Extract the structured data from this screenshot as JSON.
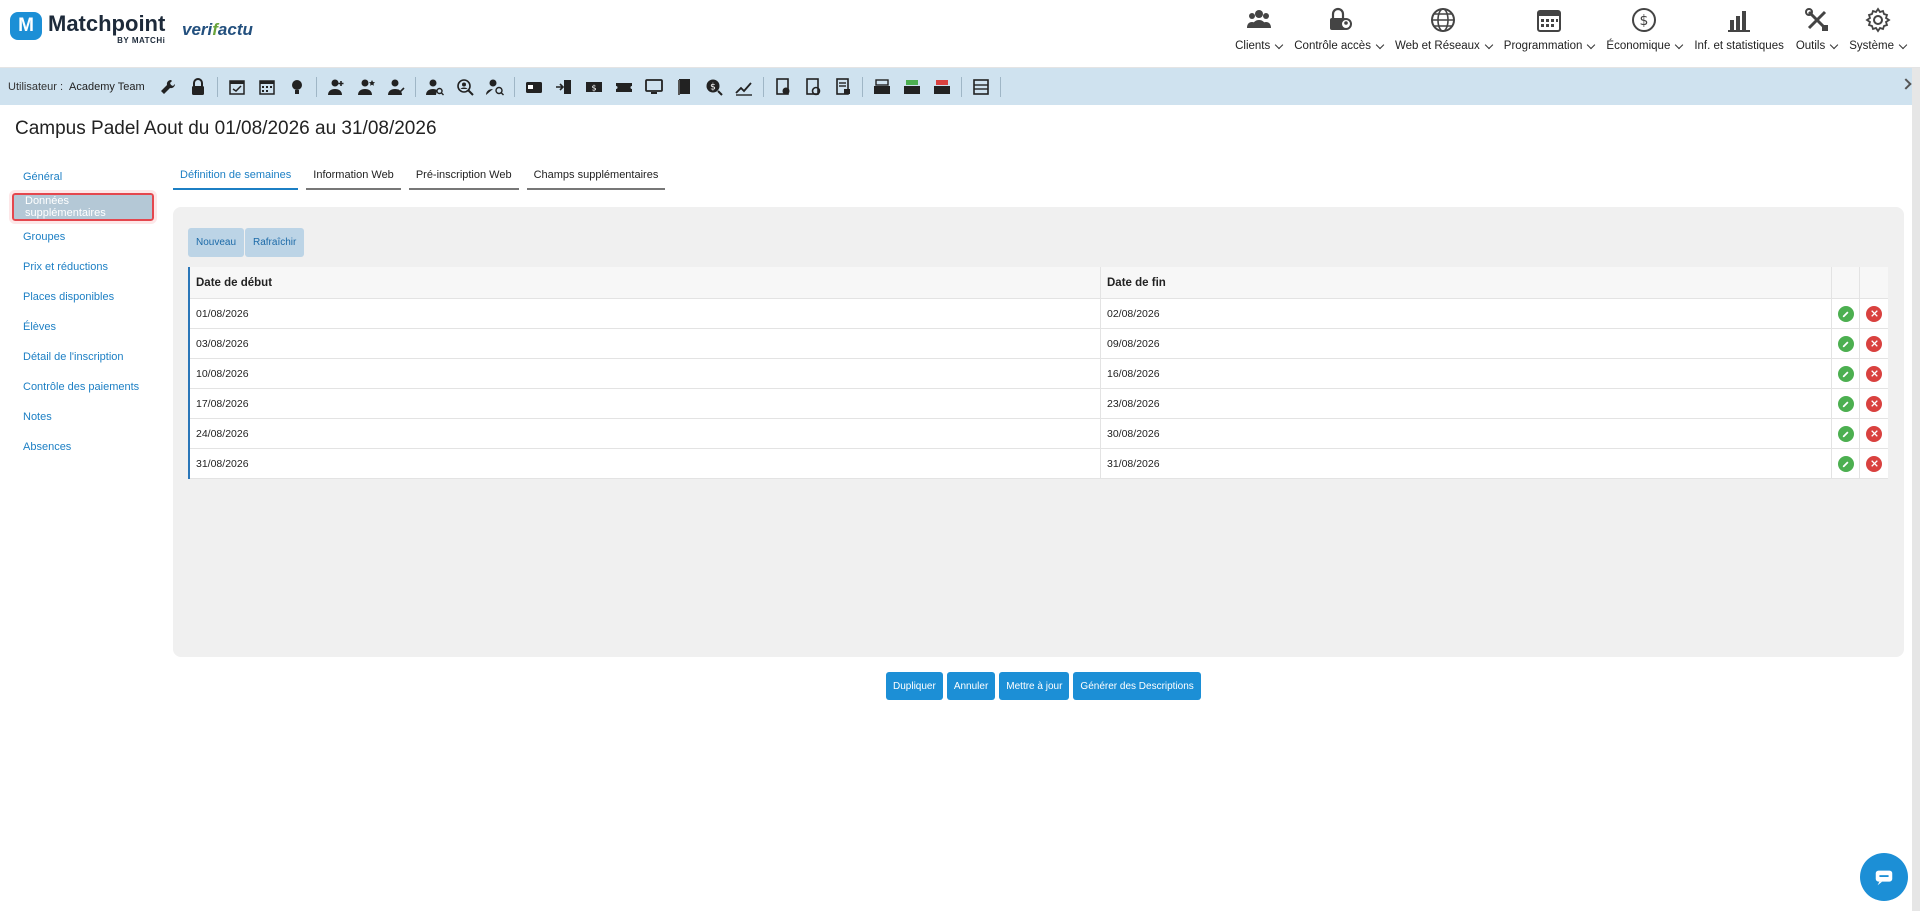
{
  "logo": {
    "letter": "M",
    "name": "Matchpoint",
    "by": "BY MATCHi",
    "partner_prefix": "veri",
    "partner_highlight": "f",
    "partner_suffix": "actu"
  },
  "menu": [
    {
      "label": "Clients",
      "icon": "users-icon",
      "dropdown": true
    },
    {
      "label": "Contrôle accès",
      "icon": "lock-person-icon",
      "dropdown": true
    },
    {
      "label": "Web et Réseaux",
      "icon": "globe-icon",
      "dropdown": true
    },
    {
      "label": "Programmation",
      "icon": "calendar-icon",
      "dropdown": true
    },
    {
      "label": "Économique",
      "icon": "dollar-icon",
      "dropdown": true
    },
    {
      "label": "Inf. et statistiques",
      "icon": "bar-chart-icon",
      "dropdown": false
    },
    {
      "label": "Outils",
      "icon": "tools-icon",
      "dropdown": true
    },
    {
      "label": "Système",
      "icon": "gear-icon",
      "dropdown": true
    }
  ],
  "toolbar": {
    "user_label": "Utilisateur :",
    "user_name": "Academy Team"
  },
  "page": {
    "title": "Campus Padel Aout du 01/08/2026 au 31/08/2026"
  },
  "sidenav": [
    {
      "label": "Général",
      "active": false
    },
    {
      "label": "Données supplémentaires",
      "active": true
    },
    {
      "label": "Groupes",
      "active": false
    },
    {
      "label": "Prix et réductions",
      "active": false
    },
    {
      "label": "Places disponibles",
      "active": false
    },
    {
      "label": "Élèves",
      "active": false
    },
    {
      "label": "Détail de l'inscription",
      "active": false
    },
    {
      "label": "Contrôle des paiements",
      "active": false
    },
    {
      "label": "Notes",
      "active": false
    },
    {
      "label": "Absences",
      "active": false
    }
  ],
  "tabs": [
    {
      "label": "Définition de semaines",
      "active": true
    },
    {
      "label": "Information Web",
      "active": false
    },
    {
      "label": "Pré-inscription Web",
      "active": false
    },
    {
      "label": "Champs supplémentaires",
      "active": false
    }
  ],
  "panel": {
    "new_label": "Nouveau",
    "refresh_label": "Rafraîchir",
    "columns": [
      "Date de début",
      "Date de fin"
    ],
    "rows": [
      [
        "01/08/2026",
        "02/08/2026"
      ],
      [
        "03/08/2026",
        "09/08/2026"
      ],
      [
        "10/08/2026",
        "16/08/2026"
      ],
      [
        "17/08/2026",
        "23/08/2026"
      ],
      [
        "24/08/2026",
        "30/08/2026"
      ],
      [
        "31/08/2026",
        "31/08/2026"
      ]
    ]
  },
  "actions": [
    "Dupliquer",
    "Annuler",
    "Mettre à jour",
    "Générer des Descriptions"
  ],
  "colors": {
    "accent": "#1c8fd6",
    "toolbar_bg": "#cfe2ef",
    "highlight_border": "#e4474e",
    "edit": "#4caf50",
    "delete": "#d9413f"
  }
}
